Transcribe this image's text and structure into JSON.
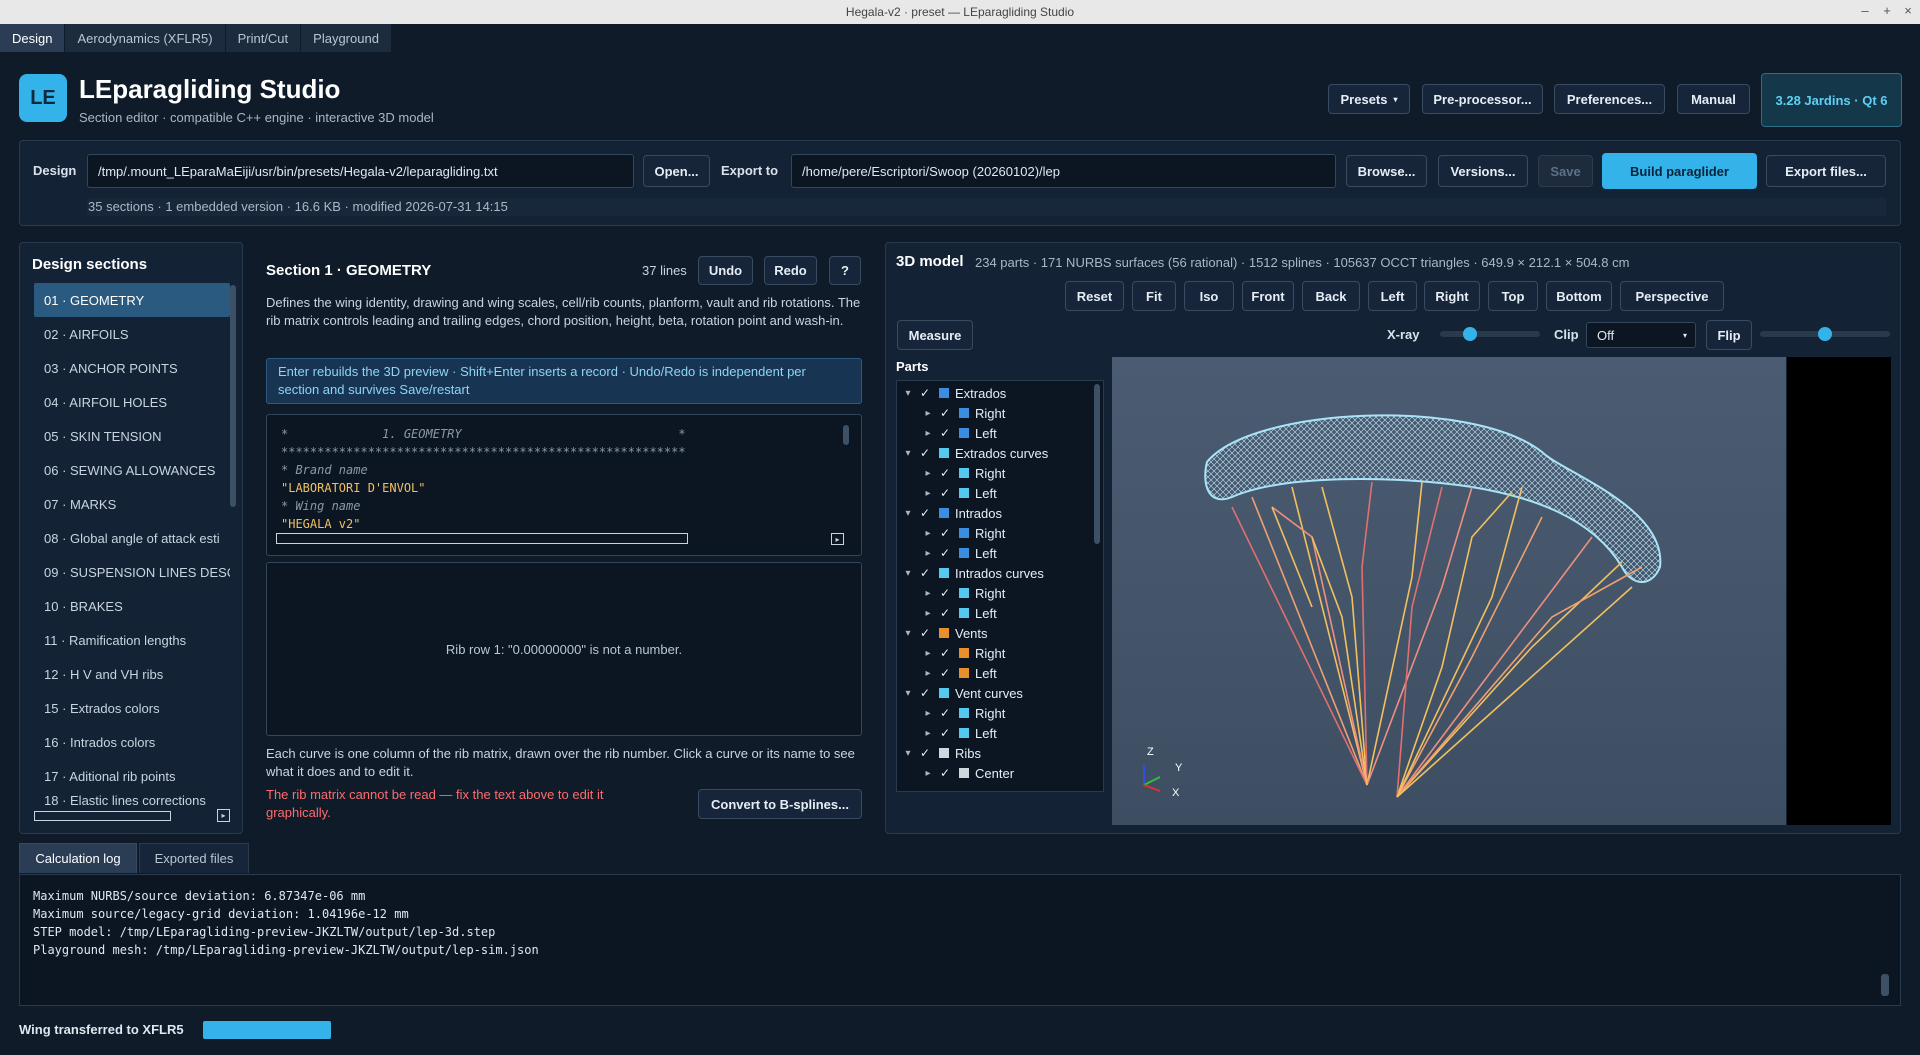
{
  "window": {
    "title": "Hegala-v2 · preset — LEparagliding Studio",
    "controls": [
      "–",
      "+",
      "×"
    ]
  },
  "tabs": [
    "Design",
    "Aerodynamics (XFLR5)",
    "Print/Cut",
    "Playground"
  ],
  "header": {
    "logo": "LE",
    "title": "LEparagliding Studio",
    "subtitle": "Section editor · compatible C++ engine · interactive 3D model",
    "presets": "Presets",
    "preprocessor": "Pre-processor...",
    "preferences": "Preferences...",
    "manual": "Manual",
    "version": "3.28 Jardins · Qt 6"
  },
  "designbar": {
    "design_label": "Design",
    "design_path": "/tmp/.mount_LEparaMaEiji/usr/bin/presets/Hegala-v2/leparagliding.txt",
    "open": "Open...",
    "export_label": "Export to",
    "export_path": "/home/pere/Escriptori/Swoop (20260102)/lep",
    "browse": "Browse...",
    "versions": "Versions...",
    "save": "Save",
    "build": "Build paraglider",
    "export_files": "Export files...",
    "info": "35 sections · 1 embedded version · 16.6 KB · modified 2026-07-31 14:15"
  },
  "sections": {
    "title": "Design sections",
    "items": [
      "01 · GEOMETRY",
      "02 · AIRFOILS",
      "03 · ANCHOR POINTS",
      "04 · AIRFOIL HOLES",
      "05 · SKIN TENSION",
      "06 · SEWING ALLOWANCES",
      "07 · MARKS",
      "08 · Global angle of attack esti",
      "09 · SUSPENSION LINES DESCR",
      "10 · BRAKES",
      "11 · Ramification lengths",
      "12 · H V and VH ribs",
      "15 · Extrados colors",
      "16 · Intrados colors",
      "17 · Aditional rib points",
      "18 · Elastic lines corrections"
    ]
  },
  "editor": {
    "title": "Section 1 · GEOMETRY",
    "lines": "37 lines",
    "undo": "Undo",
    "redo": "Redo",
    "help": "?",
    "description": "Defines the wing identity, drawing and wing scales, cell/rib counts, planform, vault and rib rotations. The rib matrix controls leading and trailing edges, chord position, height, beta, rotation point and wash-in.",
    "hint": "Enter rebuilds the 3D preview · Shift+Enter inserts a record · Undo/Redo is independent per section and survives Save/restart",
    "code": [
      "*             1. GEOMETRY                              *",
      "********************************************************",
      "* Brand name",
      "\"LABORATORI D'ENVOL\"",
      "* Wing name",
      "\"HEGALA v2\""
    ],
    "matrix_message": "Rib row 1: \"0.00000000\" is not a number.",
    "curve_help": "Each curve is one column of the rib matrix, drawn over the rib number. Click a curve or its name to see what it does and to edit it.",
    "error": "The rib matrix cannot be read — fix the text above to edit it graphically.",
    "convert": "Convert to B-splines..."
  },
  "model": {
    "title": "3D model",
    "stats": "234 parts · 171 NURBS surfaces (56 rational) · 1512 splines · 105637 OCCT triangles · 649.9 × 212.1 × 504.8 cm",
    "views": [
      "Reset",
      "Fit",
      "Iso",
      "Front",
      "Back",
      "Left",
      "Right",
      "Top",
      "Bottom",
      "Perspective"
    ],
    "measure": "Measure",
    "xray": "X-ray",
    "xray_level": 0.3,
    "clip": "Clip",
    "clip_value": "Off",
    "flip": "Flip",
    "clip_level": 0.5,
    "parts_title": "Parts",
    "tree": [
      {
        "label": "Extrados",
        "depth": 0,
        "color": "#3b8de0"
      },
      {
        "label": "Right",
        "depth": 1,
        "color": "#3b8de0"
      },
      {
        "label": "Left",
        "depth": 1,
        "color": "#3b8de0"
      },
      {
        "label": "Extrados curves",
        "depth": 0,
        "color": "#55c8f0"
      },
      {
        "label": "Right",
        "depth": 1,
        "color": "#55c8f0"
      },
      {
        "label": "Left",
        "depth": 1,
        "color": "#55c8f0"
      },
      {
        "label": "Intrados",
        "depth": 0,
        "color": "#3b8de0"
      },
      {
        "label": "Right",
        "depth": 1,
        "color": "#3b8de0"
      },
      {
        "label": "Left",
        "depth": 1,
        "color": "#3b8de0"
      },
      {
        "label": "Intrados curves",
        "depth": 0,
        "color": "#55c8f0"
      },
      {
        "label": "Right",
        "depth": 1,
        "color": "#55c8f0"
      },
      {
        "label": "Left",
        "depth": 1,
        "color": "#55c8f0"
      },
      {
        "label": "Vents",
        "depth": 0,
        "color": "#e8902a"
      },
      {
        "label": "Right",
        "depth": 1,
        "color": "#e8902a"
      },
      {
        "label": "Left",
        "depth": 1,
        "color": "#e8902a"
      },
      {
        "label": "Vent curves",
        "depth": 0,
        "color": "#55c8f0"
      },
      {
        "label": "Right",
        "depth": 1,
        "color": "#55c8f0"
      },
      {
        "label": "Left",
        "depth": 1,
        "color": "#55c8f0"
      },
      {
        "label": "Ribs",
        "depth": 0,
        "color": "#cfd6de"
      },
      {
        "label": "Center",
        "depth": 1,
        "color": "#cfd6de"
      }
    ],
    "axes": {
      "z": "Z",
      "y": "Y",
      "x": "X"
    }
  },
  "bottom": {
    "tabs": [
      "Calculation log",
      "Exported files"
    ],
    "log": [
      "Maximum NURBS/source deviation: 6.87347e-06 mm",
      "Maximum source/legacy-grid deviation: 1.04196e-12 mm",
      "STEP model: /tmp/LEparagliding-preview-JKZLTW/output/lep-3d.step",
      "Playground mesh: /tmp/LEparagliding-preview-JKZLTW/output/lep-sim.json"
    ],
    "status": "Wing transferred to XFLR5",
    "progress": 1.0
  },
  "colors": {
    "accent": "#34b3ea",
    "background": "#0f1b29",
    "panel": "#132234",
    "error": "#ff6b6b"
  }
}
